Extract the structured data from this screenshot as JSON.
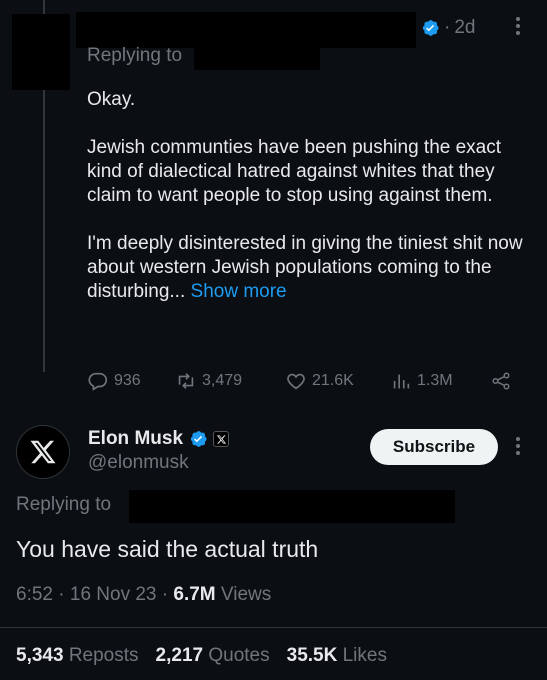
{
  "parent": {
    "time": "2d",
    "replying_to_label": "Replying to",
    "paragraphs": [
      "Okay.",
      "Jewish communties have been pushing the exact kind of dialectical hatred against whites that they claim to want people to stop using against them.",
      "I'm deeply disinterested in giving the tiniest shit now about western Jewish populations coming to the disturbing..."
    ],
    "show_more": "Show more",
    "actions": {
      "replies": "936",
      "reposts": "3,479",
      "likes": "21.6K",
      "views": "1.3M"
    }
  },
  "tweet": {
    "author_name": "Elon Musk",
    "handle": "@elonmusk",
    "subscribe_label": "Subscribe",
    "replying_to_label": "Replying to",
    "text": "You have said the actual truth",
    "time": "6:52",
    "date": "16 Nov 23",
    "views_count": "6.7M",
    "views_label": "Views",
    "stats": {
      "reposts_count": "5,343",
      "reposts_label": "Reposts",
      "quotes_count": "2,217",
      "quotes_label": "Quotes",
      "likes_count": "35.5K",
      "likes_label": "Likes"
    }
  },
  "colors": {
    "background": "#0b0f14",
    "accent": "#1d9bf0",
    "muted": "#71767b",
    "text": "#e7e9ea"
  }
}
